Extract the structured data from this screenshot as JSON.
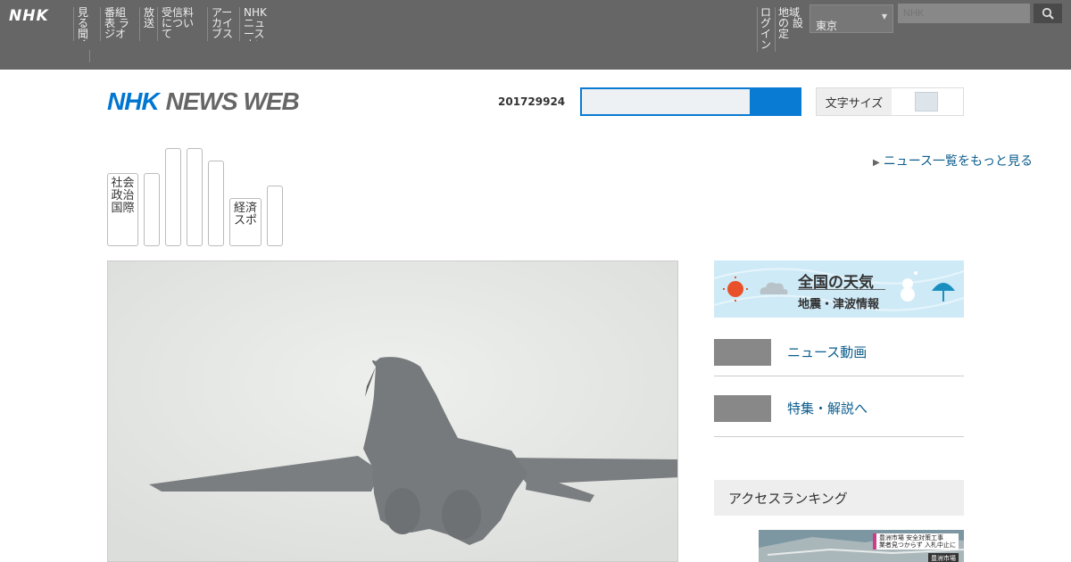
{
  "global_bar": {
    "logo": "NHK",
    "nav": [
      {
        "label": "見る聞く"
      },
      {
        "label": "番組表 ラジオ"
      },
      {
        "label": "放送"
      },
      {
        "label": "受信料 について"
      },
      {
        "label": "アーカイ ブス"
      },
      {
        "label": "NHK ニュース オンデマンド"
      }
    ],
    "right_items": [
      {
        "label": "ログイン"
      },
      {
        "label": "地域の 設定"
      }
    ],
    "region_select": "東京",
    "search_placeholder": "NHK"
  },
  "header": {
    "logo_nhk": "NHK",
    "logo_news_web": "NEWS WEB",
    "date": "201729924",
    "mode_label": "文字サイズ"
  },
  "categories": [
    {
      "label": "社会 政治 国際"
    },
    {
      "label": ""
    },
    {
      "label": ""
    },
    {
      "label": ""
    },
    {
      "label": ""
    },
    {
      "label": "経済 スポ"
    },
    {
      "label": ""
    }
  ],
  "side_link": "ニュース一覧をもっと見る",
  "weather": {
    "title": "全国の天気",
    "subtitle": "地震・津波情報"
  },
  "right_links": [
    {
      "label": "ニュース動画"
    },
    {
      "label": "特集・解説へ"
    }
  ],
  "ranking_title": "アクセスランキング",
  "ranking_thumb": {
    "caption1": "豊洲市場 安全対策工事",
    "caption2": "業者見つからず 入札中止に",
    "caption3": "豊洲市場"
  }
}
